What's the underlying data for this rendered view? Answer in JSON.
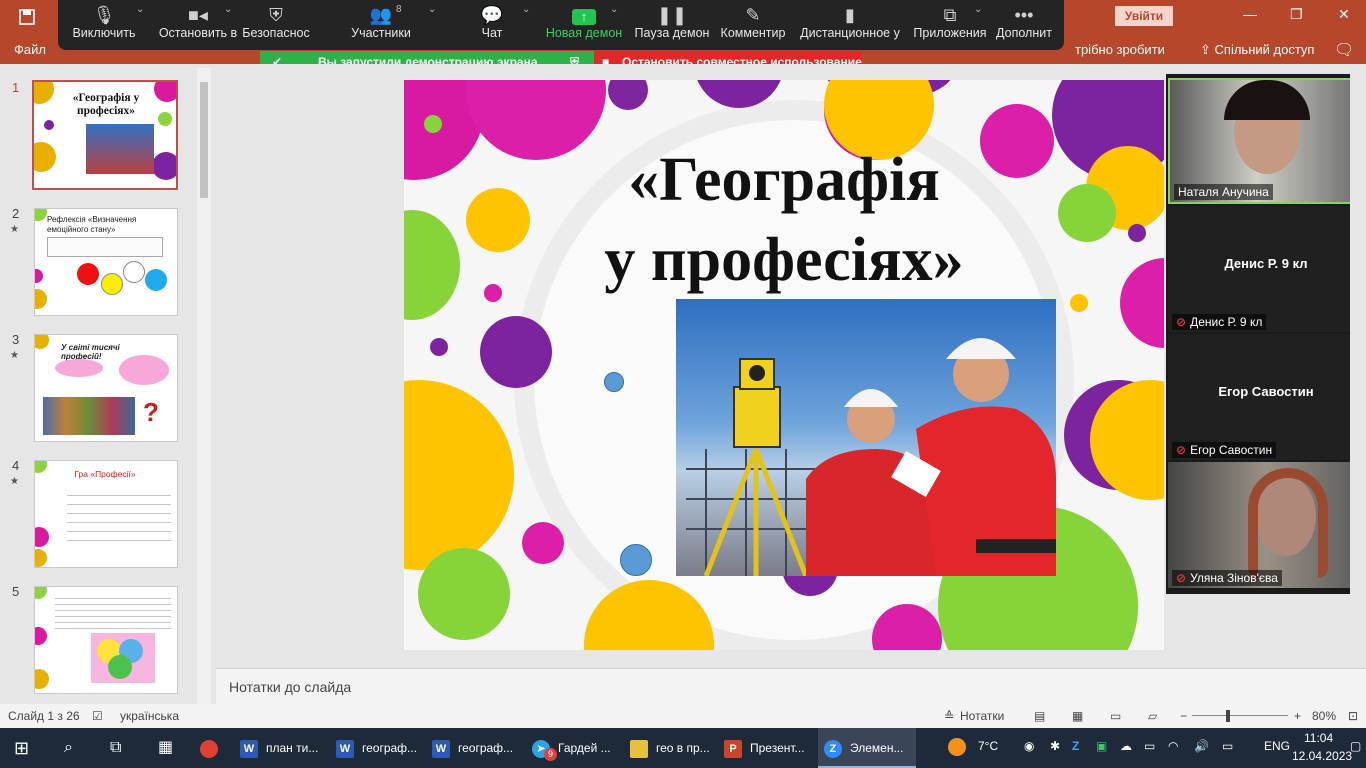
{
  "powerpoint": {
    "menu_first": "Файл",
    "menu_tail": "трібно зробити",
    "share_label": "Спільний доступ",
    "signin_label": "Увійти"
  },
  "zoom_toolbar": {
    "buttons": [
      {
        "label": "Виключить",
        "icon": "microphone-icon"
      },
      {
        "label": "Остановить в",
        "icon": "video-camera-icon"
      },
      {
        "label": "Безопаснос",
        "icon": "shield-icon"
      },
      {
        "label": "Участники",
        "icon": "participants-icon",
        "count": "8"
      },
      {
        "label": "Чат",
        "icon": "chat-icon"
      },
      {
        "label": "Новая демон",
        "icon": "share-screen-icon"
      },
      {
        "label": "Пауза демон",
        "icon": "pause-icon"
      },
      {
        "label": "Комментир",
        "icon": "pencil-icon"
      },
      {
        "label": "Дистанционное у",
        "icon": "mouse-icon"
      },
      {
        "label": "Приложения",
        "icon": "apps-icon"
      },
      {
        "label": "Дополнит",
        "icon": "more-icon"
      }
    ],
    "sharing_banner": "Вы запустили демонстрацию экрана",
    "stop_sharing": "Остановить совместное использование",
    "accent_green": "#23c552",
    "accent_red": "#e02828"
  },
  "thumbnails": {
    "slides": [
      {
        "num": "1",
        "title": "«Географія у професіях»"
      },
      {
        "num": "2",
        "title": "Рефлексія «Визначення емоційного стану»",
        "star": "★"
      },
      {
        "num": "3",
        "title": "У світі тисячі професій!",
        "star": "★"
      },
      {
        "num": "4",
        "title": "Гра «Професії»",
        "star": "★"
      },
      {
        "num": "5",
        "title": "",
        "star": ""
      }
    ]
  },
  "slide": {
    "title": "«Географія\nу професіях»"
  },
  "notes": {
    "placeholder": "Нотатки до слайда"
  },
  "participants": [
    {
      "name": "Наталя Анучина",
      "video": true
    },
    {
      "name": "Денис Р. 9 кл",
      "video": false,
      "muted": true
    },
    {
      "name": "Егор Савостин",
      "video": false,
      "muted": true
    },
    {
      "name": "Уляна Зінов'єва",
      "video": true,
      "muted": true
    }
  ],
  "statusbar": {
    "slide_counter": "Слайд 1 з 26",
    "language": "українська",
    "notes_button": "Нотатки",
    "zoom_level": "80%"
  },
  "taskbar": {
    "apps": [
      {
        "label": "план ти...",
        "icon": "word-icon"
      },
      {
        "label": "географ...",
        "icon": "word-icon"
      },
      {
        "label": "географ...",
        "icon": "word-icon"
      },
      {
        "label": "Гардей ...",
        "icon": "telegram-icon",
        "badge": "9"
      },
      {
        "label": "гео в пр...",
        "icon": "folder-icon"
      },
      {
        "label": "Презент...",
        "icon": "powerpoint-icon"
      },
      {
        "label": "Элемен...",
        "icon": "zoom-icon"
      }
    ],
    "weather": "7°C",
    "lang": "ENG",
    "time": "11:04",
    "date": "12.04.2023"
  }
}
